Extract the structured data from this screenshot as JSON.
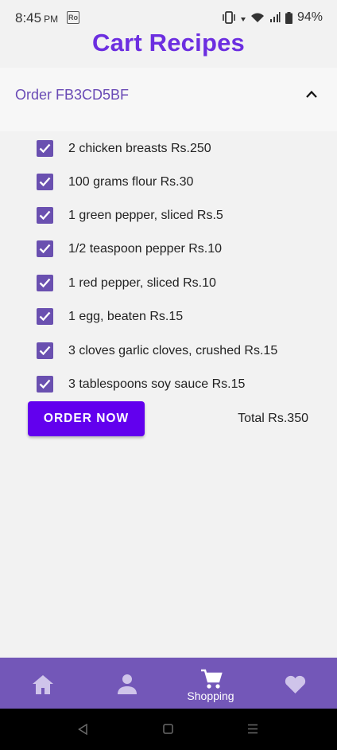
{
  "status_bar": {
    "time": "8:45",
    "ampm": "PM",
    "ro_badge": "Ro",
    "battery": "94%"
  },
  "title": "Cart Recipes",
  "order": {
    "title": "Order FB3CD5BF",
    "expanded": true,
    "items": [
      {
        "label": "2 chicken breasts Rs.250",
        "checked": true
      },
      {
        "label": "100 grams flour Rs.30",
        "checked": true
      },
      {
        "label": "1 green pepper, sliced Rs.5",
        "checked": true
      },
      {
        "label": "1/2 teaspoon pepper Rs.10",
        "checked": true
      },
      {
        "label": "1 red pepper, sliced Rs.10",
        "checked": true
      },
      {
        "label": "1 egg, beaten Rs.15",
        "checked": true
      },
      {
        "label": "3 cloves garlic cloves, crushed Rs.15",
        "checked": true
      },
      {
        "label": "3 tablespoons soy sauce Rs.15",
        "checked": true
      }
    ],
    "order_button": "ORDER NOW",
    "total": "Total Rs.350"
  },
  "bottom_nav": {
    "items": [
      {
        "icon": "home-icon",
        "label": ""
      },
      {
        "icon": "person-icon",
        "label": ""
      },
      {
        "icon": "cart-icon",
        "label": "Shopping",
        "active": true
      },
      {
        "icon": "heart-icon",
        "label": ""
      }
    ]
  },
  "colors": {
    "accent": "#6200ee",
    "title": "#6c2ee0",
    "nav_bg": "#7357b8",
    "checkbox": "#6a50b0"
  }
}
